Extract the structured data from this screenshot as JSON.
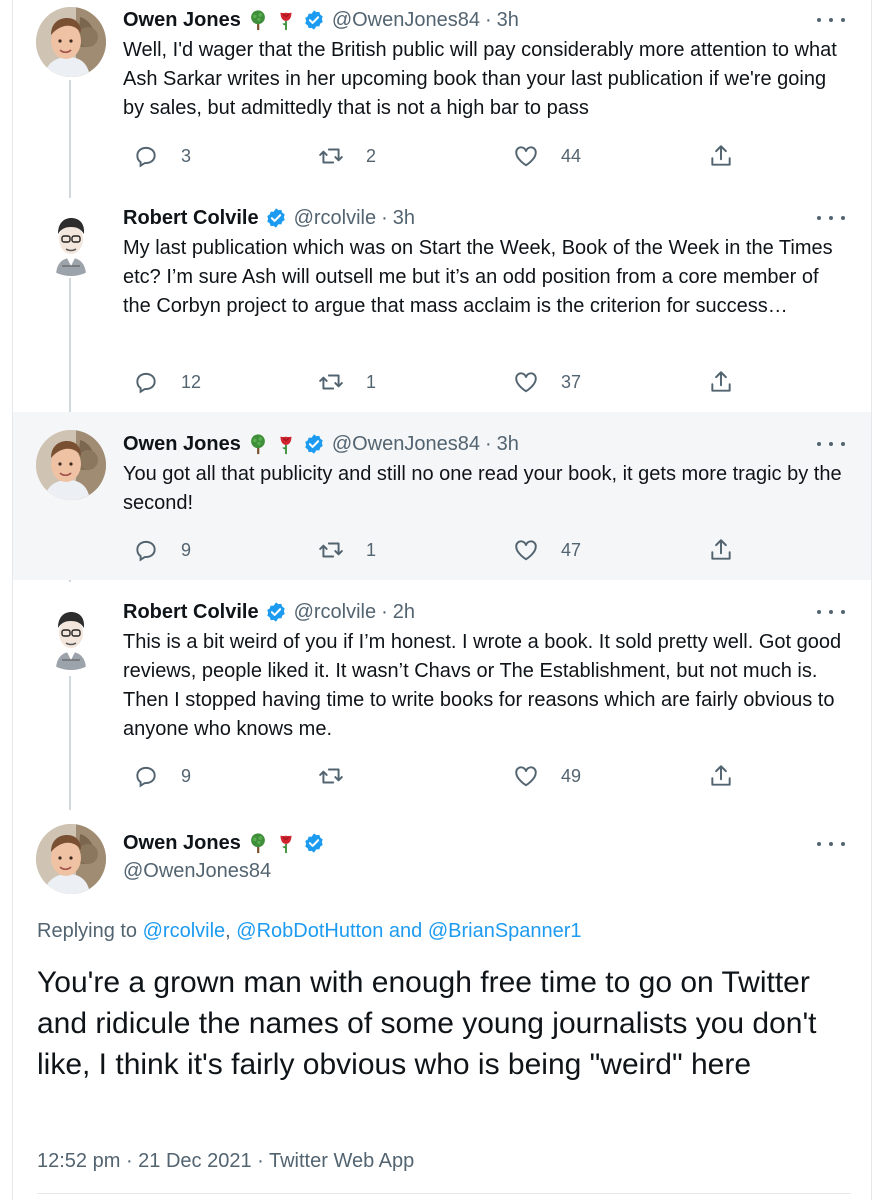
{
  "tweets": [
    {
      "name": "Owen Jones",
      "handle": "@OwenJones84",
      "time": "3h",
      "text": "Well, I'd wager that the British public will pay considerably more attention to what Ash Sarkar writes in her upcoming book than your last publication if we're going by sales, but admittedly that is not a high bar to pass",
      "replies": "3",
      "retweets": "2",
      "likes": "44"
    },
    {
      "name": "Robert Colvile",
      "handle": "@rcolvile",
      "time": "3h",
      "text": "My last publication which was on Start the Week, Book of the Week in the Times etc? I’m sure Ash will outsell me but it’s an odd position from a core member of the Corbyn project to argue that mass acclaim is the criterion for success…",
      "replies": "12",
      "retweets": "1",
      "likes": "37"
    },
    {
      "name": "Owen Jones",
      "handle": "@OwenJones84",
      "time": "3h",
      "text": "You got all that publicity and still no one read your book, it gets more tragic by the second!",
      "replies": "9",
      "retweets": "1",
      "likes": "47"
    },
    {
      "name": "Robert Colvile",
      "handle": "@rcolvile",
      "time": "2h",
      "text": "This is a bit weird of you if I’m honest. I wrote a book. It sold pretty well. Got good reviews, people liked it. It wasn’t Chavs or The Establishment, but not much is. Then I stopped having time to write books for reasons which are fairly obvious to anyone who knows me.",
      "replies": "9",
      "retweets": "",
      "likes": "49"
    }
  ],
  "main_tweet": {
    "name": "Owen Jones",
    "handle": "@OwenJones84",
    "replying_prefix": "Replying to ",
    "replying_user1": "@rcolvile",
    "replying_comma": ", ",
    "replying_user2": "@RobDotHutton",
    "replying_and": " and ",
    "replying_user3": "@BrianSpanner1",
    "text": "You're a grown man with enough free time to go on Twitter and ridicule the names of some young journalists you don't like, I think it's fairly obvious who is being \"weird\" here",
    "timestamp": "12:52 pm · 21 Dec 2021 · Twitter Web App"
  },
  "separator": "·",
  "icons": {
    "reply": "reply-icon",
    "retweet": "retweet-icon",
    "like": "heart-icon",
    "share": "share-icon",
    "verified": "verified-badge-icon",
    "tree": "tree-emoji-icon",
    "rose": "rose-emoji-icon",
    "more": "more-options-icon"
  },
  "colors": {
    "link": "#1d9bf0",
    "secondary_text": "#536471",
    "highlight_bg": "#f5f6f7",
    "verified": "#1d9bf0"
  }
}
